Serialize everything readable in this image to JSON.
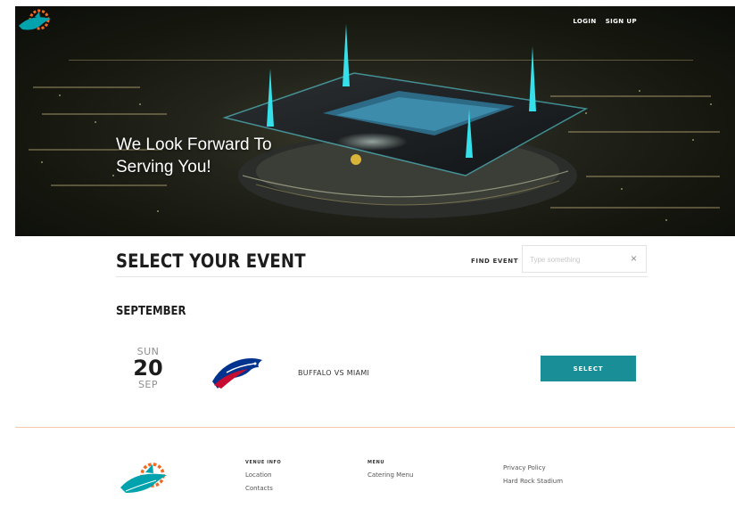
{
  "header": {
    "login_label": "LOGIN",
    "signup_label": "SIGN UP"
  },
  "hero": {
    "title_line1": "We Look Forward To",
    "title_line2": "Serving You!"
  },
  "events": {
    "title": "SELECT YOUR EVENT",
    "find_label": "FIND EVENT",
    "search_placeholder": "Type something",
    "search_value": "",
    "clear_icon": "×",
    "month": "SEPTEMBER",
    "items": [
      {
        "dow": "SUN",
        "day": "20",
        "mon": "SEP",
        "matchup": "BUFFALO VS MIAMI",
        "select_label": "SELECT",
        "logo_icon": "buffalo-bills-logo"
      }
    ]
  },
  "footer": {
    "venue_info": {
      "heading": "VENUE INFO",
      "links": [
        "Location",
        "Contacts"
      ]
    },
    "menu": {
      "heading": "MENU",
      "links": [
        "Catering Menu"
      ]
    },
    "misc": {
      "links": [
        "Privacy Policy",
        "Hard Rock Stadium"
      ]
    }
  },
  "colors": {
    "accent_teal": "#1a8e96",
    "divider_orange": "#f6c9ad",
    "dolphins_aqua": "#008e97",
    "dolphins_orange": "#fc4c02",
    "bills_blue": "#00338d",
    "bills_red": "#c60c30"
  }
}
